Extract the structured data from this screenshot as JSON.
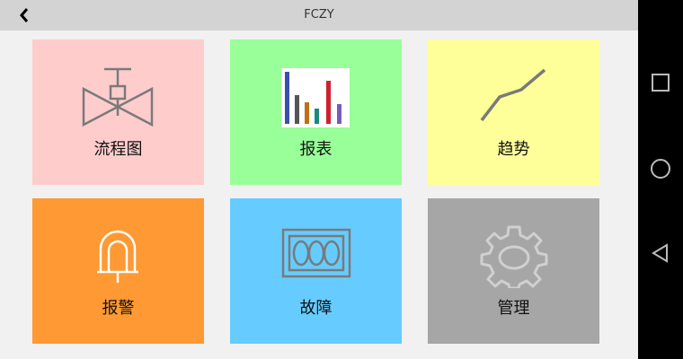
{
  "header": {
    "title": "FCZY",
    "back_icon": "chevron-left-icon"
  },
  "tiles": [
    {
      "label": "流程图",
      "color": "#ffcccc",
      "icon": "valve-icon"
    },
    {
      "label": "报表",
      "color": "#99ff99",
      "icon": "bar-chart-icon"
    },
    {
      "label": "趋势",
      "color": "#ffff99",
      "icon": "trend-line-icon"
    },
    {
      "label": "报警",
      "color": "#ff9933",
      "icon": "alarm-light-icon"
    },
    {
      "label": "故障",
      "color": "#66ccff",
      "icon": "fault-panel-icon"
    },
    {
      "label": "管理",
      "color": "#a6a6a6",
      "icon": "gear-icon"
    }
  ],
  "nav": {
    "recent_icon": "square-icon",
    "home_icon": "circle-icon",
    "back_icon": "triangle-back-icon"
  }
}
